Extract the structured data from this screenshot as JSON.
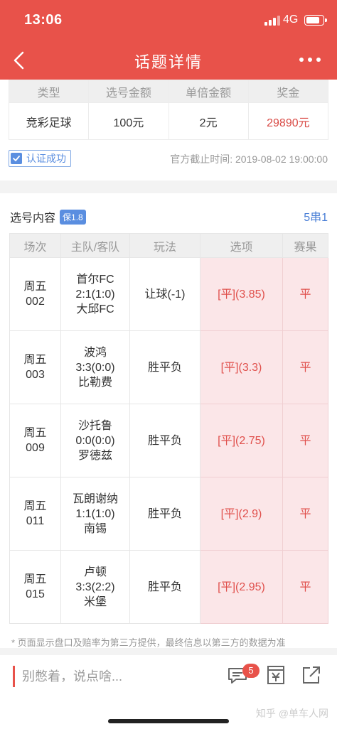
{
  "status_bar": {
    "time": "13:06",
    "network": "4G",
    "battery_level": 0.85
  },
  "nav": {
    "title": "话题详情"
  },
  "summary": {
    "headers": [
      "类型",
      "选号金额",
      "单倍金额",
      "奖金"
    ],
    "values": [
      "竞彩足球",
      "100元",
      "2元",
      "29890元"
    ],
    "verify_label": "认证成功",
    "deadline": "官方截止时间: 2019-08-02 19:00:00"
  },
  "selection": {
    "title": "选号内容",
    "badge": "保1.8",
    "chuan": "5串1",
    "headers": [
      "场次",
      "主队/客队",
      "玩法",
      "选项",
      "赛果"
    ],
    "rows": [
      {
        "day": "周五",
        "num": "002",
        "home": "首尔FC",
        "score": "2:1(1:0)",
        "away": "大邱FC",
        "play": "让球(-1)",
        "option": "[平](3.85)",
        "result": "平"
      },
      {
        "day": "周五",
        "num": "003",
        "home": "波鸿",
        "score": "3:3(0:0)",
        "away": "比勒费",
        "play": "胜平负",
        "option": "[平](3.3)",
        "result": "平"
      },
      {
        "day": "周五",
        "num": "009",
        "home": "沙托鲁",
        "score": "0:0(0:0)",
        "away": "罗德兹",
        "play": "胜平负",
        "option": "[平](2.75)",
        "result": "平"
      },
      {
        "day": "周五",
        "num": "011",
        "home": "瓦朗谢纳",
        "score": "1:1(1:0)",
        "away": "南锡",
        "play": "胜平负",
        "option": "[平](2.9)",
        "result": "平"
      },
      {
        "day": "周五",
        "num": "015",
        "home": "卢顿",
        "score": "3:3(2:2)",
        "away": "米堡",
        "play": "胜平负",
        "option": "[平](2.95)",
        "result": "平"
      }
    ]
  },
  "disclaimer": "* 页面显示盘口及赔率为第三方提供，最终信息以第三方的数据为准",
  "bottom": {
    "comment_placeholder": "别憋着，说点啥...",
    "comment_count": "5",
    "watermark": "知乎 @单车人网"
  },
  "colors": {
    "header": "#e8524a",
    "prize": "#d94a45",
    "accent_blue": "#5a8ee0",
    "highlight_bg": "#fbe6e8"
  }
}
